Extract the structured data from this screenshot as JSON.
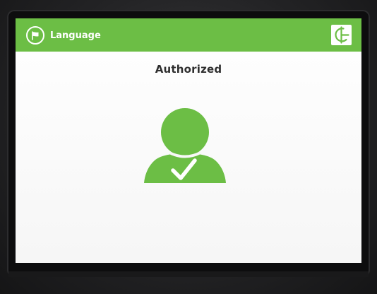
{
  "header": {
    "language_label": "Language",
    "language_icon": "flag-icon",
    "logo_icon": "brand-logo-icon",
    "accent_color": "#6cbe45"
  },
  "status": {
    "title": "Authorized",
    "icon": "user-check-icon",
    "icon_color": "#6cbe45"
  }
}
